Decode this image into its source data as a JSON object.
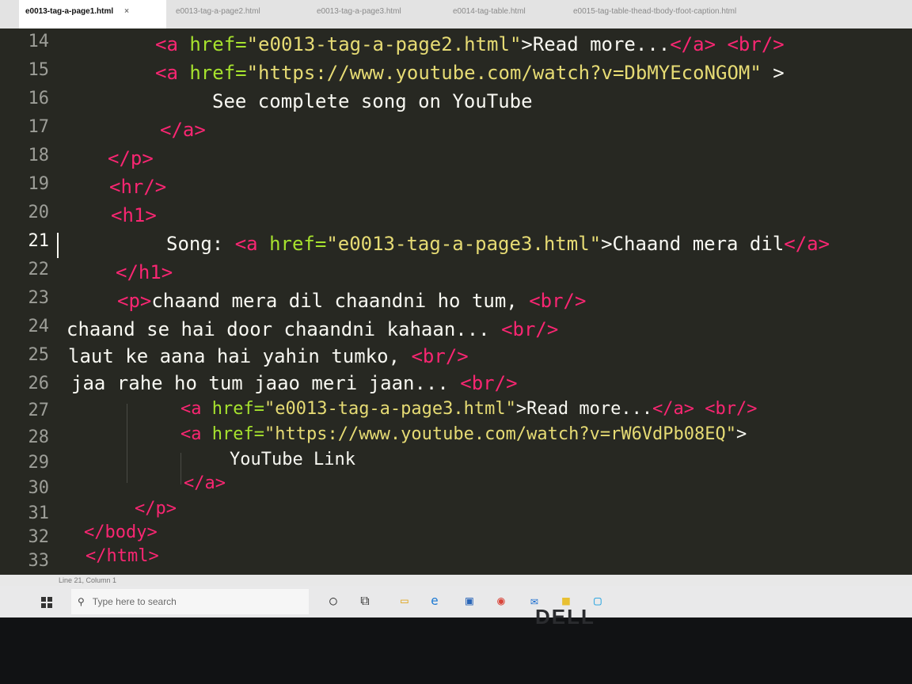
{
  "tabs": [
    {
      "label": "e0013-tag-a-page1.html",
      "close": "×"
    },
    {
      "label": "e0013-tag-a-page2.html"
    },
    {
      "label": "e0013-tag-a-page3.html"
    },
    {
      "label": "e0014-tag-table.html"
    },
    {
      "label": "e0015-tag-table-thead-tbody-tfoot-caption.html"
    }
  ],
  "editor": {
    "line_numbers": [
      "14",
      "15",
      "16",
      "17",
      "18",
      "19",
      "20",
      "21",
      "22",
      "23",
      "24",
      "25",
      "26",
      "27",
      "28",
      "29",
      "30",
      "31",
      "32",
      "33"
    ],
    "current_line": "21",
    "lines": {
      "l14": {
        "open": "<a ",
        "attr": "href=",
        "val": "\"e0013-tag-a-page2.html\"",
        "rest": ">Read more...",
        "close": "</a>",
        "sp": " ",
        "br": "<br/>"
      },
      "l15": {
        "open": "<a ",
        "attr": "href=",
        "val": "\"https://www.youtube.com/watch?v=DbMYEcoNGOM\"",
        "rest": " >"
      },
      "l16": {
        "text": "See complete song on YouTube"
      },
      "l17": {
        "close": "</a>"
      },
      "l18": {
        "close": "</p>"
      },
      "l19": {
        "tag": "<hr/>"
      },
      "l20": {
        "tag": "<h1>"
      },
      "l21": {
        "pre": "Song: ",
        "open": "<a ",
        "attr": "href=",
        "val": "\"e0013-tag-a-page3.html\"",
        "rest": ">Chaand mera dil",
        "close": "</a>"
      },
      "l22": {
        "close": "</h1>"
      },
      "l23": {
        "open": "<p>",
        "text": "chaand mera dil chaandni ho tum, ",
        "br": "<br/>"
      },
      "l24": {
        "text": "chaand se hai door chaandni kahaan... ",
        "br": "<br/>"
      },
      "l25": {
        "text": "laut ke aana hai yahin tumko, ",
        "br": "<br/>"
      },
      "l26": {
        "text": "jaa rahe ho tum jaao meri jaan... ",
        "br": "<br/>"
      },
      "l27": {
        "open": "<a ",
        "attr": "href=",
        "val": "\"e0013-tag-a-page3.html\"",
        "rest": ">Read more...",
        "close": "</a>",
        "sp": " ",
        "br": "<br/>"
      },
      "l28": {
        "open": "<a ",
        "attr": "href=",
        "val": "\"https://www.youtube.com/watch?v=rW6VdPb08EQ\"",
        "rest": ">"
      },
      "l29": {
        "text": "YouTube Link"
      },
      "l30": {
        "close": "</a>"
      },
      "l31": {
        "close": "</p>"
      },
      "l32": {
        "close": "</body>"
      },
      "l33": {
        "close": "</html>"
      }
    }
  },
  "status_bar": {
    "position": "Line 21, Column 1"
  },
  "taskbar": {
    "search_placeholder": "Type here to search",
    "icons": [
      "windows-start-icon",
      "cortana-circle-icon",
      "task-view-icon",
      "file-explorer-icon",
      "edge-icon",
      "store-icon",
      "chrome-icon",
      "mail-icon",
      "sticky-notes-icon",
      "skype-icon"
    ]
  },
  "hardware": {
    "brand": "DELL"
  },
  "colors": {
    "tag": "#f92672",
    "attribute": "#a6e22e",
    "string": "#e6db74",
    "text": "#f8f8f2",
    "background": "#272822"
  }
}
